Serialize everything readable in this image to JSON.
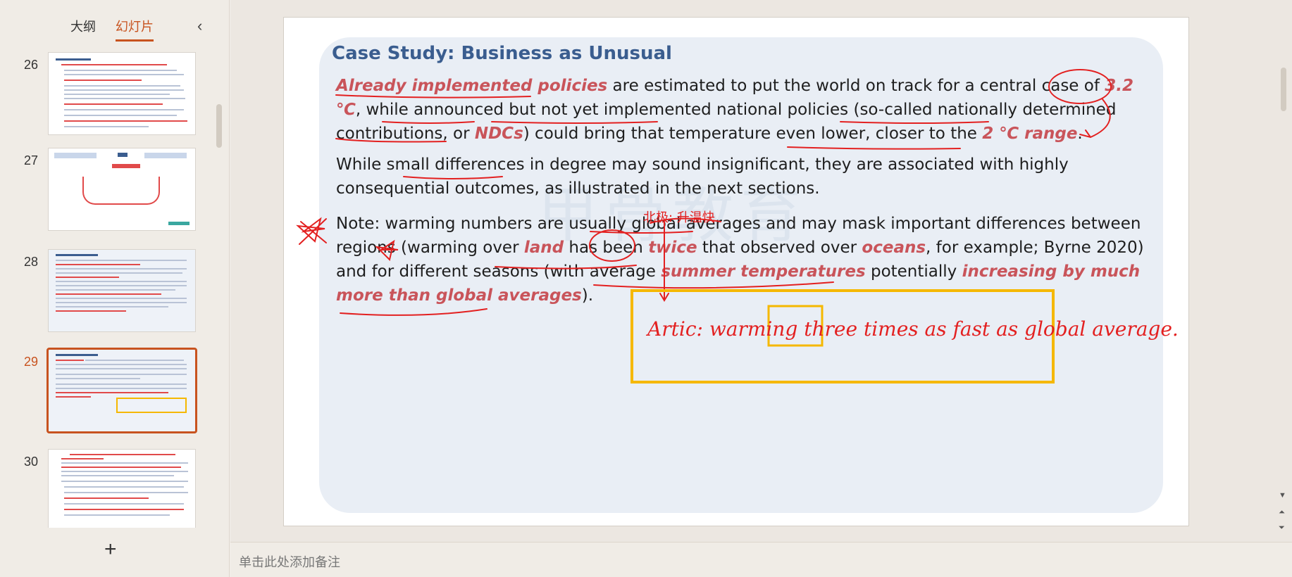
{
  "left_panel": {
    "tabs": [
      {
        "label": "大纲",
        "active": false
      },
      {
        "label": "幻灯片",
        "active": true
      }
    ],
    "collapse_icon": "chevron-left-icon",
    "slides": [
      {
        "number": "26"
      },
      {
        "number": "27"
      },
      {
        "number": "28"
      },
      {
        "number": "29",
        "active": true
      },
      {
        "number": "30"
      }
    ],
    "add_slide_label": "+"
  },
  "slide": {
    "title": "Case Study: Business as Unusual",
    "watermark": "甲骨教育",
    "p1": {
      "s1": "Already implemented policies",
      "s2": " are estimated to put the world on track for a central case of ",
      "s3": "3.2 ℃",
      "s4": ", while announced but not yet implemented national policies (so-called nationally determined contributions, or ",
      "s5": "NDCs",
      "s6": ") could bring that temperature even lower, closer to the ",
      "s7": "2 ℃ range",
      "s8": "."
    },
    "p2": "While small differences in degree may sound insignificant, they are associated with highly consequential outcomes, as illustrated in the next sections.",
    "p3": {
      "s1": "Note: warming numbers are usually global averages and may mask important differences between regions (warming over ",
      "s2": "land",
      "s3": " has been ",
      "s4": "twice",
      "s5": " that observed over ",
      "s6": "oceans",
      "s7": ", for example; Byrne 2020) and for different seasons (with average ",
      "s8": "summer temperatures",
      "s9": " potentially ",
      "s10": "increasing by much more than global averages",
      "s11": ")."
    },
    "handwriting": {
      "note": "Artic: warming three times as fast as global average.",
      "annotation": "北极: 升温快"
    }
  },
  "notes": {
    "placeholder": "单击此处添加备注"
  },
  "colors": {
    "accent": "#c8531f",
    "title": "#3a5d8f",
    "emphasis": "#c9545a",
    "ink": "#e32020",
    "highlight_box": "#f5b800"
  }
}
